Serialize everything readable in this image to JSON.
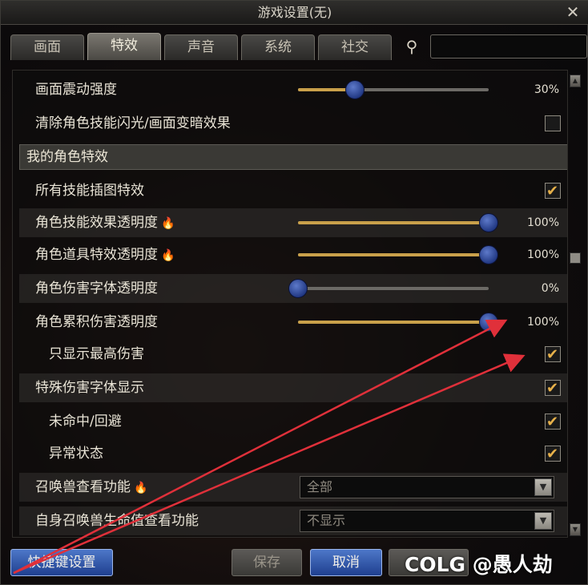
{
  "window": {
    "title": "游戏设置(无)",
    "close_label": "✕"
  },
  "tabs": [
    {
      "label": "画面",
      "active": false
    },
    {
      "label": "特效",
      "active": true
    },
    {
      "label": "声音",
      "active": false
    },
    {
      "label": "系统",
      "active": false
    },
    {
      "label": "社交",
      "active": false
    }
  ],
  "search": {
    "placeholder": ""
  },
  "rows": {
    "screen_shake": {
      "label": "画面震动强度",
      "value_text": "30%",
      "value": 30
    },
    "clear_flash": {
      "label": "清除角色技能闪光/画面变暗效果",
      "checked": false
    },
    "section_my_effects": {
      "label": "我的角色特效"
    },
    "skill_illustration": {
      "label": "所有技能插图特效",
      "checked": true
    },
    "skill_effect_opacity": {
      "label": "角色技能效果透明度",
      "value_text": "100%",
      "value": 100
    },
    "item_effect_opacity": {
      "label": "角色道具特效透明度",
      "value_text": "100%",
      "value": 100
    },
    "damage_font_opacity": {
      "label": "角色伤害字体透明度",
      "value_text": "0%",
      "value": 0
    },
    "accum_damage_opacity": {
      "label": "角色累积伤害透明度",
      "value_text": "100%",
      "value": 100
    },
    "show_highest_damage": {
      "label": "只显示最高伤害",
      "checked": true
    },
    "special_damage_font": {
      "label": "特殊伤害字体显示",
      "checked": true
    },
    "miss_evade": {
      "label": "未命中/回避",
      "checked": true
    },
    "abnormal_status": {
      "label": "异常状态",
      "checked": true
    },
    "summon_view": {
      "label": "召唤兽查看功能",
      "selected": "全部"
    },
    "summon_hp_view": {
      "label": "自身召唤兽生命值查看功能",
      "selected": "不显示"
    }
  },
  "buttons": {
    "quick": "快捷键设置",
    "save": "保存",
    "cancel": "取消"
  },
  "watermark": "COLG @愚人劫",
  "colors": {
    "accent_gold": "#c9a04a",
    "knob_blue": "#2c4a9a",
    "arrow_red": "#e0303a"
  }
}
